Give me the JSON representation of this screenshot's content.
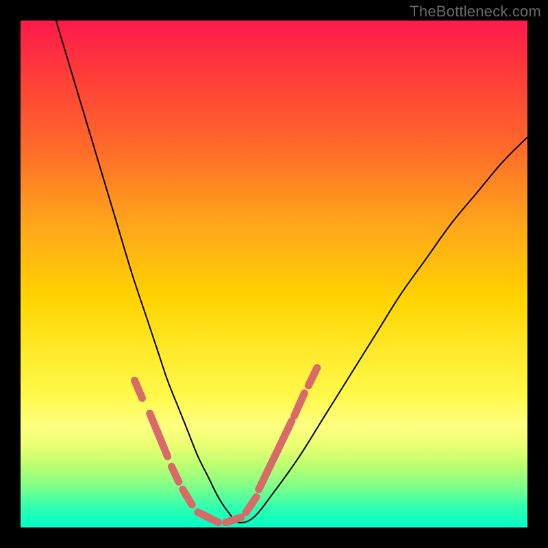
{
  "watermark": "TheBottleneck.com",
  "chart_data": {
    "type": "line",
    "title": "",
    "xlabel": "",
    "ylabel": "",
    "xlim": [
      0,
      100
    ],
    "ylim": [
      0,
      100
    ],
    "grid": false,
    "legend": false,
    "series": [
      {
        "name": "bottleneck-curve",
        "x": [
          7,
          10,
          13,
          16,
          19,
          22,
          25,
          27,
          29,
          31,
          33,
          35,
          37,
          39,
          41,
          43,
          46,
          50,
          55,
          60,
          65,
          70,
          75,
          80,
          85,
          90,
          95,
          100
        ],
        "y": [
          100,
          90,
          80,
          70,
          60,
          50,
          41,
          35,
          29,
          24,
          19,
          14,
          10,
          6,
          3,
          1,
          2,
          7,
          14,
          22,
          30,
          38,
          46,
          53,
          60,
          66,
          72,
          77
        ]
      }
    ],
    "markers": {
      "name": "highlight-segments",
      "segments": [
        {
          "x": [
            22.5,
            24.0
          ],
          "y": [
            29.0,
            25.5
          ]
        },
        {
          "x": [
            25.5,
            29.0
          ],
          "y": [
            22.5,
            14.0
          ]
        },
        {
          "x": [
            29.8,
            31.2
          ],
          "y": [
            12.0,
            9.0
          ]
        },
        {
          "x": [
            32.0,
            33.8
          ],
          "y": [
            7.5,
            4.5
          ]
        },
        {
          "x": [
            35.0,
            39.0
          ],
          "y": [
            3.0,
            1.0
          ]
        },
        {
          "x": [
            40.5,
            43.5
          ],
          "y": [
            1.0,
            2.0
          ]
        },
        {
          "x": [
            44.5,
            46.5
          ],
          "y": [
            3.0,
            6.0
          ]
        },
        {
          "x": [
            47.0,
            53.5
          ],
          "y": [
            7.5,
            21.0
          ]
        },
        {
          "x": [
            54.0,
            56.0
          ],
          "y": [
            22.0,
            26.5
          ]
        },
        {
          "x": [
            56.8,
            58.5
          ],
          "y": [
            28.0,
            31.5
          ]
        }
      ]
    }
  }
}
